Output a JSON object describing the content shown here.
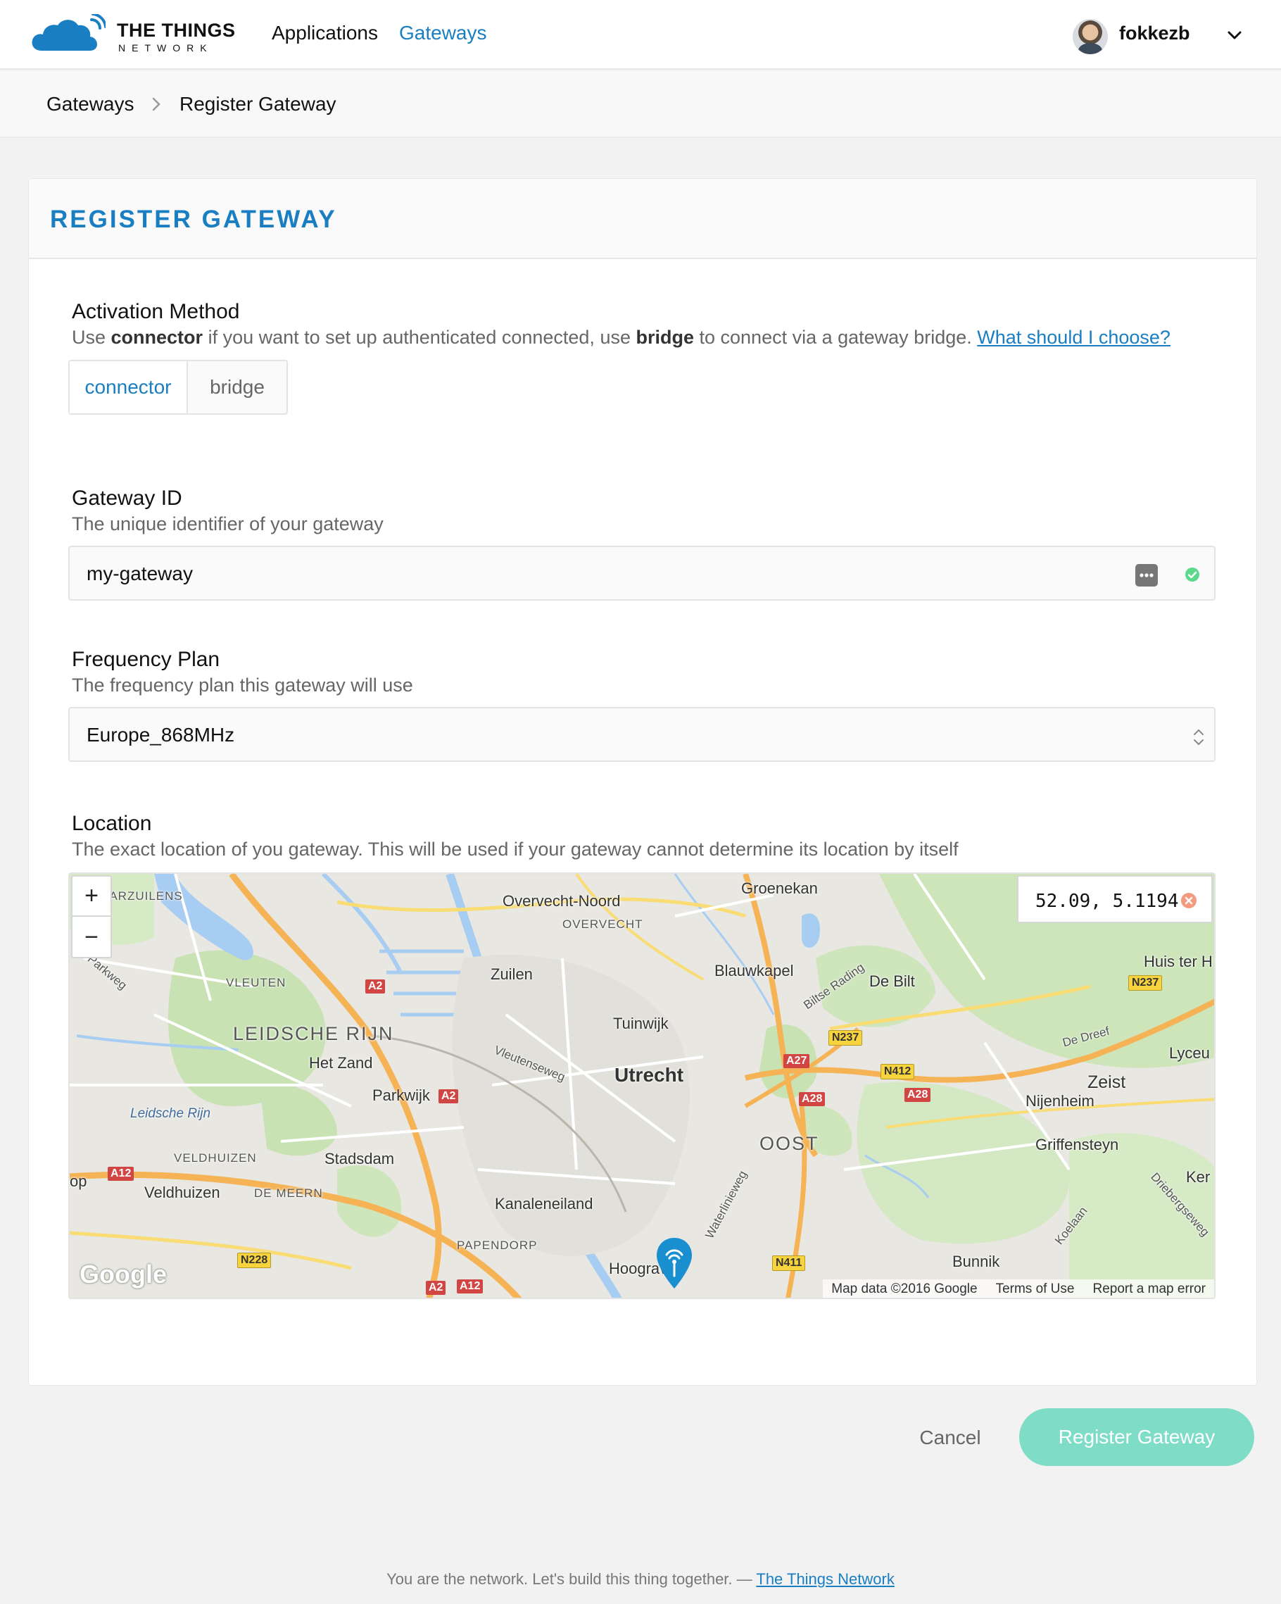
{
  "header": {
    "logo_line1": "THE THINGS",
    "logo_line2": "NETWORK",
    "nav": [
      {
        "label": "Applications",
        "active": false
      },
      {
        "label": "Gateways",
        "active": true
      }
    ],
    "username": "fokkezb"
  },
  "breadcrumb": {
    "items": [
      "Gateways",
      "Register Gateway"
    ]
  },
  "card": {
    "title": "REGISTER GATEWAY",
    "activation": {
      "label": "Activation Method",
      "desc_pre": "Use ",
      "desc_b1": "connector",
      "desc_mid": " if you want to set up authenticated connected, use ",
      "desc_b2": "bridge",
      "desc_post": " to connect via a gateway bridge. ",
      "help_link": "What should I choose?",
      "options": [
        "connector",
        "bridge"
      ],
      "selected": "connector"
    },
    "gateway_id": {
      "label": "Gateway ID",
      "desc": "The unique identifier of your gateway",
      "value": "my-gateway"
    },
    "frequency_plan": {
      "label": "Frequency Plan",
      "desc": "The frequency plan this gateway will use",
      "value": "Europe_868MHz"
    },
    "location": {
      "label": "Location",
      "desc": "The exact location of you gateway. This will be used if your gateway cannot determine its location by itself",
      "coordinates": "52.09, 5.1194",
      "zoom_in": "+",
      "zoom_out": "−",
      "google": "Google",
      "attribution": [
        "Map data ©2016 Google",
        "Terms of Use",
        "Report a map error"
      ],
      "places": {
        "aarzuilens": "AARZUILENS",
        "overvecht_noord": "Overvecht-Noord",
        "overvecht": "OVERVECHT",
        "groenekan": "Groenekan",
        "parkweg": "Parkweg",
        "vleuten": "VLEUTEN",
        "zuilen": "Zuilen",
        "blauwkapel": "Blauwkapel",
        "bilste_rading": "Biltse Rading",
        "de_bilt": "De Bilt",
        "huis_ter": "Huis ter H",
        "leidsche_rijn": "LEIDSCHE RIJN",
        "tuinwijk": "Tuinwijk",
        "de_dreef": "De Dreef",
        "het_zand": "Het Zand",
        "vleutenseweg": "Vleutenseweg",
        "utrecht": "Utrecht",
        "lyceu": "Lyceu",
        "leidsche_rijn_water": "Leidsche Rijn",
        "parkwijk": "Parkwijk",
        "zeist": "Zeist",
        "nijenheim": "Nijenheim",
        "oost": "OOST",
        "veldhuizen_caps": "VELDHUIZEN",
        "stadsdam": "Stadsdam",
        "griffensteyn": "Griffensteyn",
        "op": "op",
        "veldhuizen": "Veldhuizen",
        "de_meern": "DE MEERN",
        "waterlinieweg": "Waterlinieweg",
        "driebergseweg": "Driebergseweg",
        "ker": "Ker",
        "kanaleneiland": "Kanaleneiland",
        "koelaan": "Koelaan",
        "papendorp": "PAPENDORP",
        "hoograven": "Hoograven",
        "bunnik": "Bunnik"
      },
      "shields": {
        "a2_1": "A2",
        "a2_2": "A2",
        "a2_3": "A2",
        "a12_1": "A12",
        "a12_2": "A12",
        "a27": "A27",
        "a28_1": "A28",
        "a28_2": "A28",
        "n237_1": "N237",
        "n237_2": "N237",
        "n412": "N412",
        "n228": "N228",
        "n411": "N411"
      }
    }
  },
  "actions": {
    "cancel": "Cancel",
    "register": "Register Gateway"
  },
  "footer": {
    "text": "You are the network. Let's build this thing together. — ",
    "link": "The Things Network"
  },
  "colors": {
    "accent": "#1a7ec2",
    "button": "#7fddc7",
    "valid": "#5cd98a",
    "error": "#f39a7f",
    "marker": "#1a8fd0"
  }
}
